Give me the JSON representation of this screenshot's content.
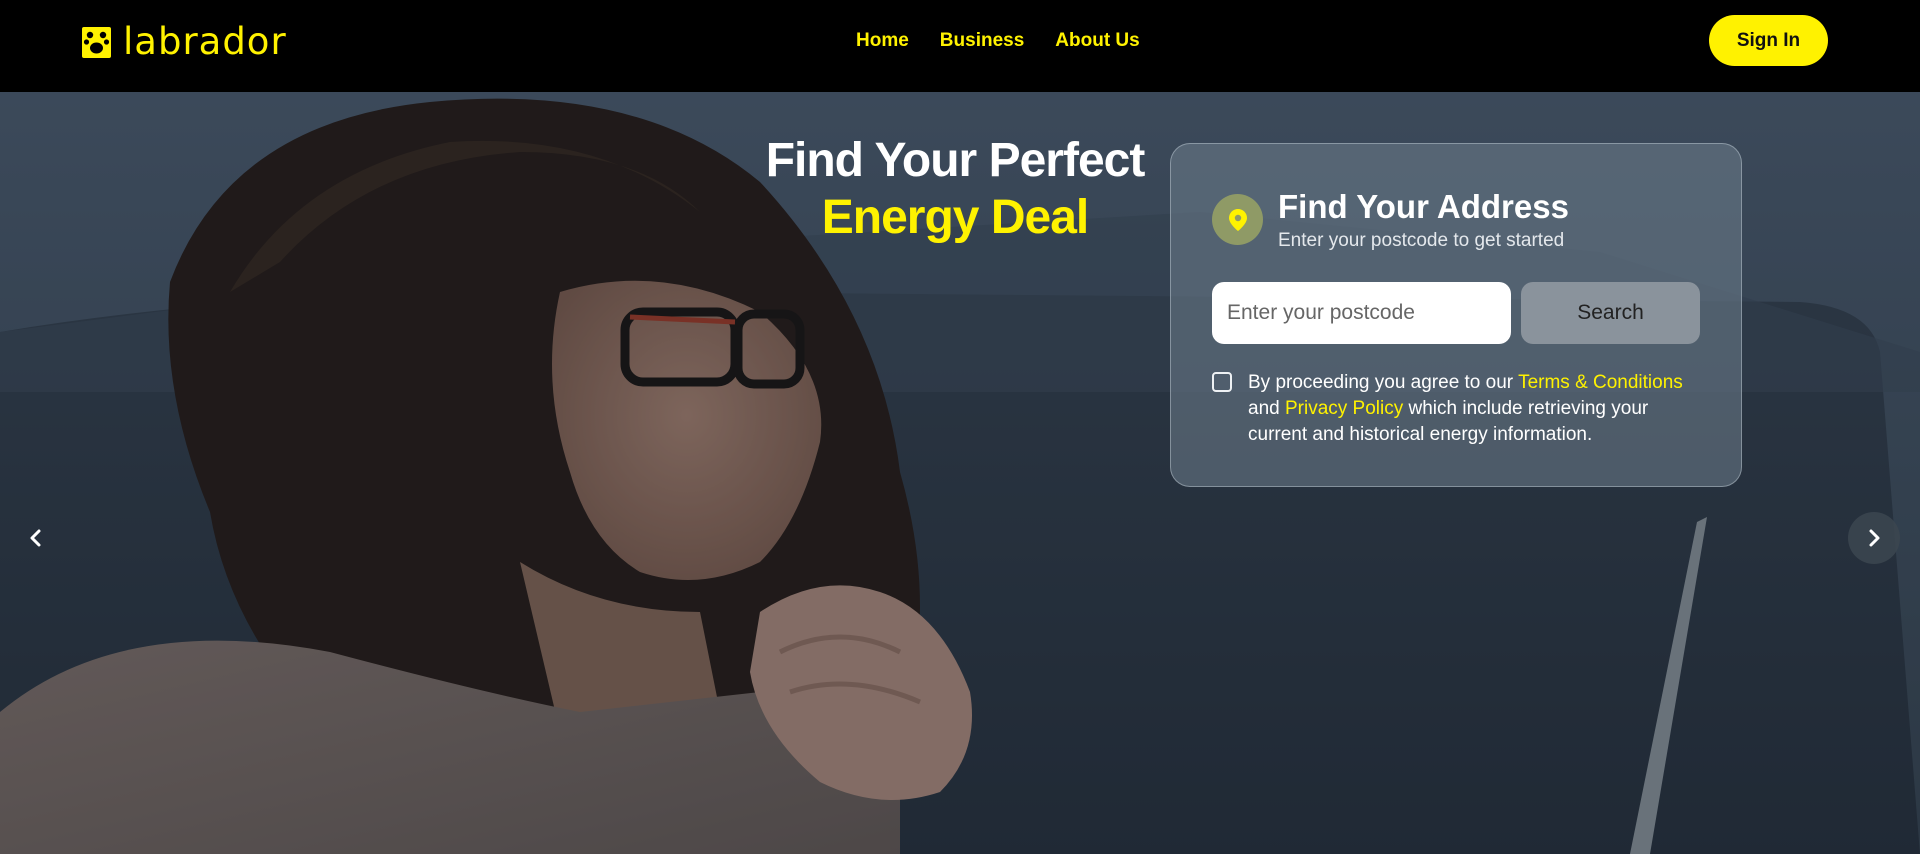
{
  "brand": {
    "name": "labrador",
    "color": "#FFF200"
  },
  "nav": {
    "items": [
      {
        "label": "Home"
      },
      {
        "label": "Business"
      },
      {
        "label": "About Us"
      }
    ],
    "signin_label": "Sign In"
  },
  "hero": {
    "headline_line1": "Find Your Perfect",
    "headline_line2": "Energy Deal",
    "prev_icon": "chevron-left-icon",
    "next_icon": "chevron-right-icon"
  },
  "address_card": {
    "icon": "map-pin-icon",
    "title": "Find Your Address",
    "subtitle": "Enter your postcode to get started",
    "postcode_placeholder": "Enter your postcode",
    "postcode_value": "",
    "search_label": "Search",
    "consent": {
      "checked": false,
      "text_before": "By proceeding you agree to our ",
      "terms_link": "Terms & Conditions",
      "text_middle": " and ",
      "privacy_link": "Privacy Policy",
      "text_after": " which include retrieving your current and historical energy information."
    }
  }
}
